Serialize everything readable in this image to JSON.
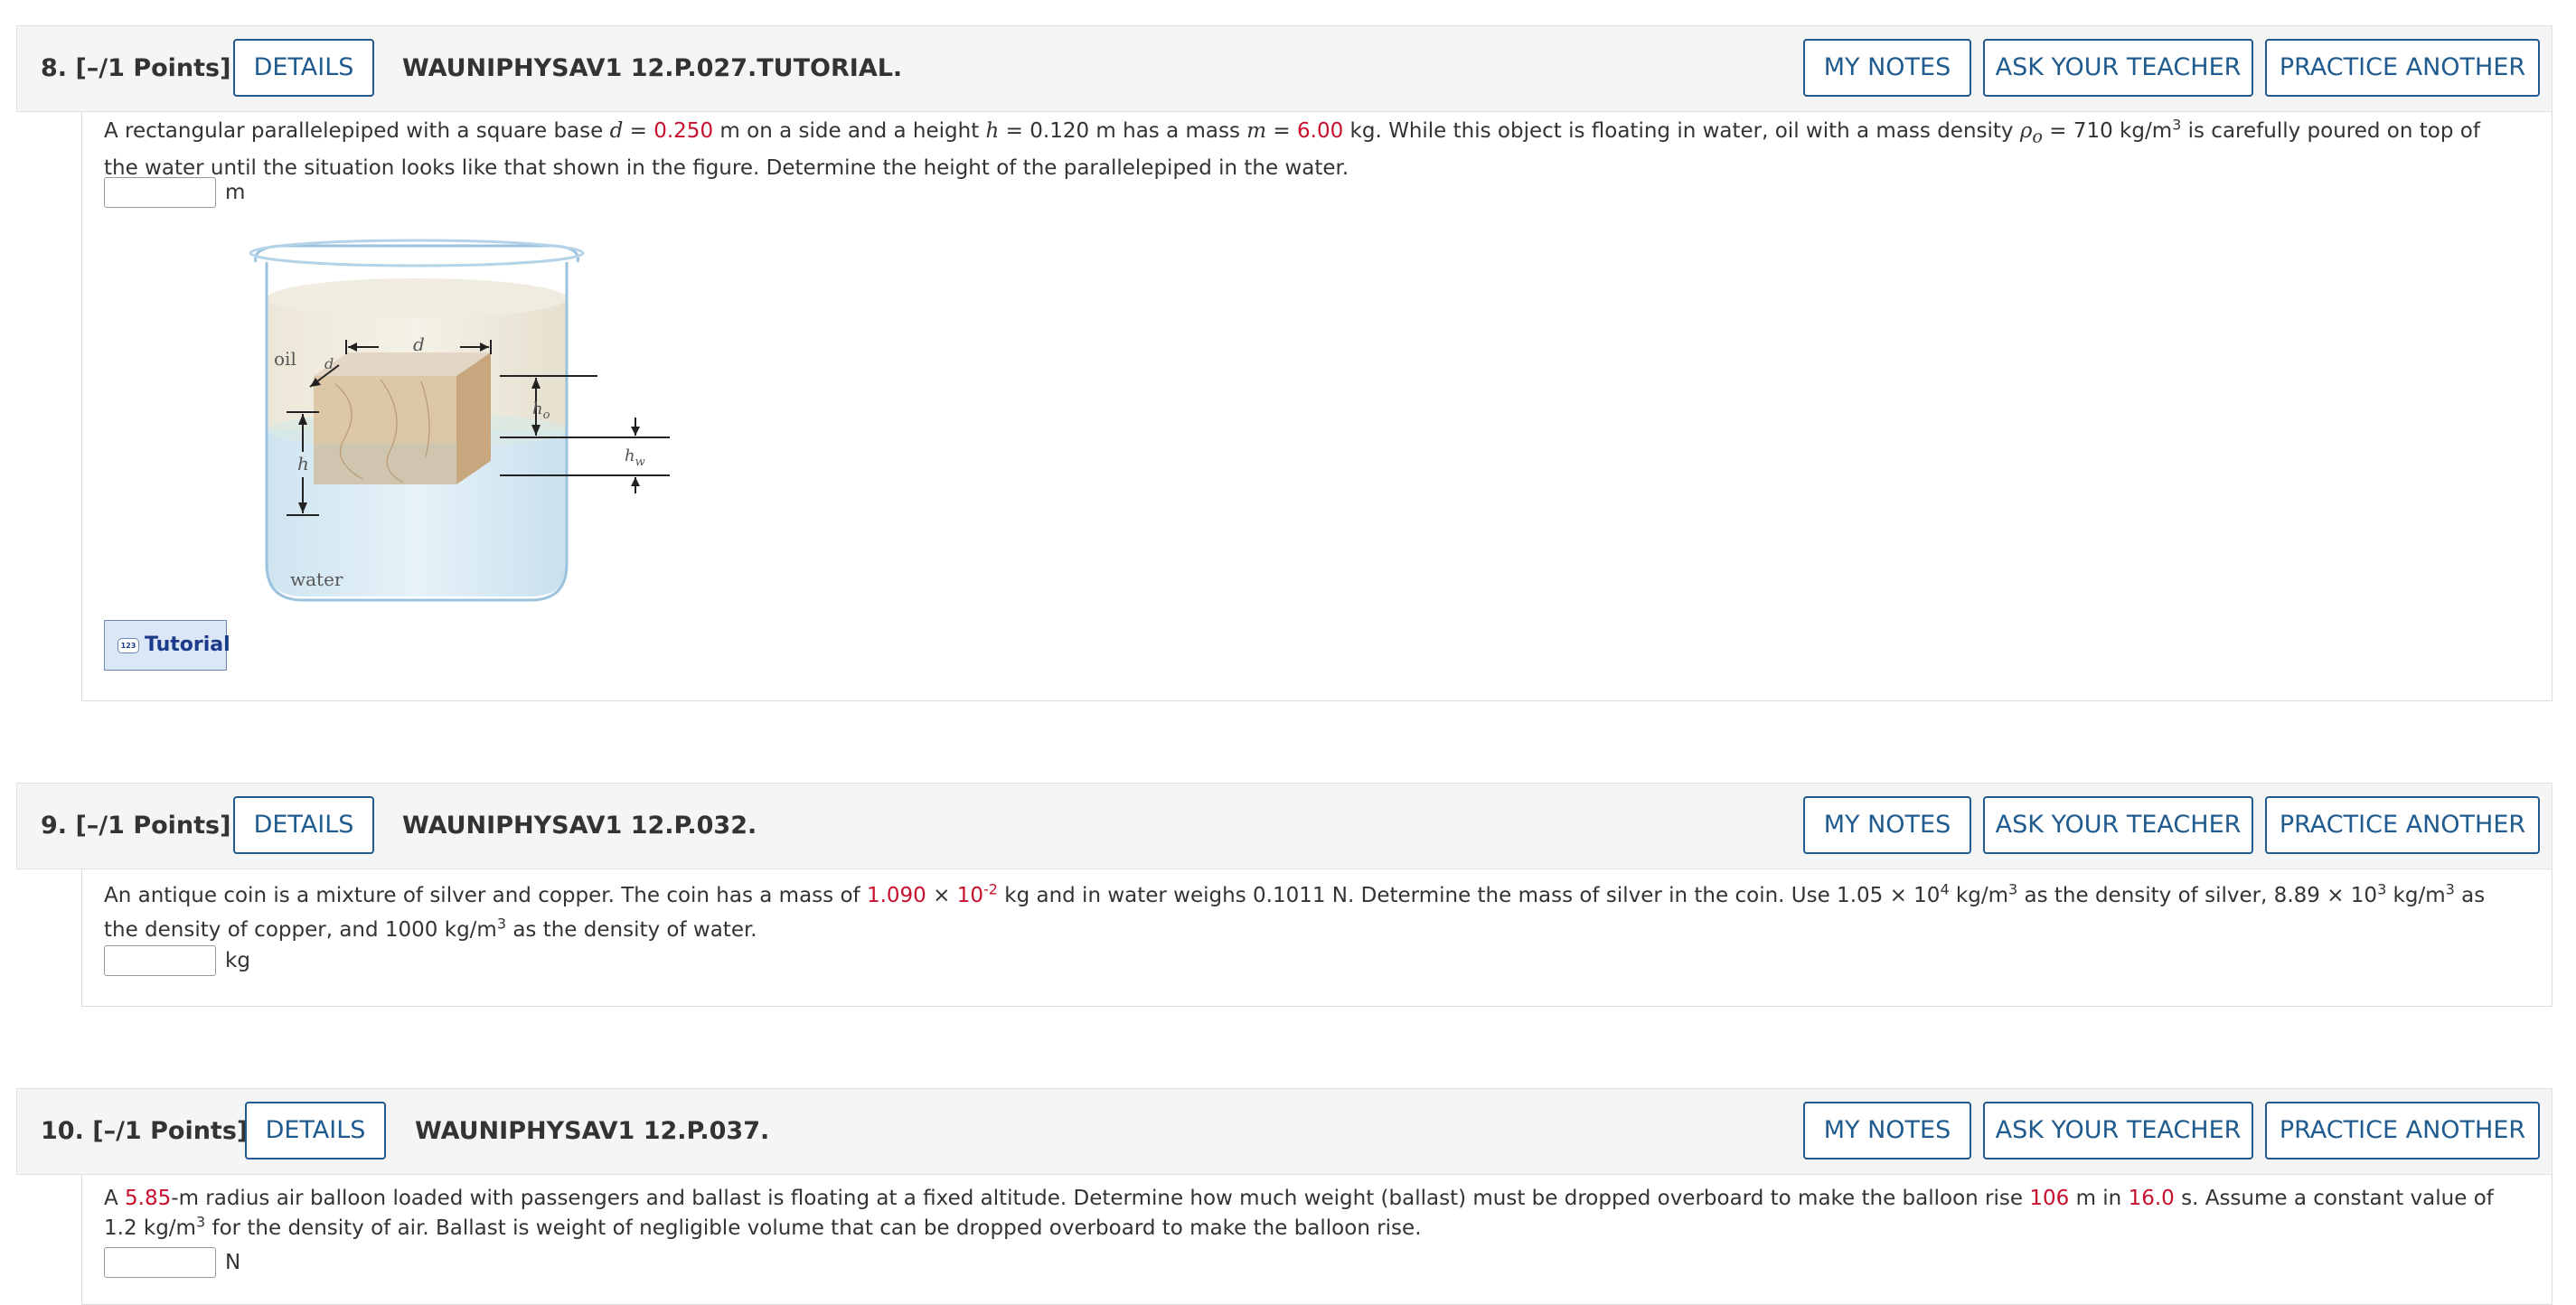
{
  "common": {
    "details": "DETAILS",
    "my_notes": "MY NOTES",
    "ask_teacher": "ASK YOUR TEACHER",
    "practice_another": "PRACTICE ANOTHER"
  },
  "q8": {
    "num": "8.  [–/1 Points]",
    "code": "WAUNIPHYSAV1 12.P.027.TUTORIAL.",
    "text": {
      "t1": "A rectangular parallelepiped with a square base ",
      "d_var": "d",
      "eq1": " = ",
      "d_val": "0.250",
      "t2": " m  on a side and a height  ",
      "h_var": "h",
      "t3": " = 0.120 m  has a mass  ",
      "m_var": "m",
      "eq2": " = ",
      "m_val": "6.00",
      "t4": " kg.  While this object is floating in water, oil with a mass density  ",
      "rho": "ρ",
      "rho_sub": "o",
      "t5": " = 710 kg/m",
      "sup3": "3",
      "t6": "  is carefully poured on top of the water until the situation looks like that shown in the figure. Determine the height of the parallelepiped in the water."
    },
    "unit": "m",
    "figure": {
      "oil": "oil",
      "water": "water",
      "d": "d",
      "h": "h",
      "ho": "h",
      "ho_sub": "o",
      "hw": "h",
      "hw_sub": "w"
    },
    "tutorial": "Tutorial",
    "tutorial_icon": "123"
  },
  "q9": {
    "num": "9.  [–/1 Points]",
    "code": "WAUNIPHYSAV1 12.P.032.",
    "text": {
      "t1": "An antique coin is a mixture of silver and copper. The coin has a mass of ",
      "mass": "1.090",
      "times": " × ",
      "ten": "10",
      "exp": "-2",
      "t2": " kg and in water weighs 0.1011 N. Determine the mass of silver in the coin. Use 1.05 × 10",
      "e4": "4",
      "t3": " kg/m",
      "s3a": "3",
      "t4": " as the density of silver, 8.89 × 10",
      "e3": "3",
      "t5": " kg/m",
      "s3b": "3",
      "t6": " as the density of copper, and 1000 kg/m",
      "s3c": "3",
      "t7": " as the density of water."
    },
    "unit": "kg"
  },
  "q10": {
    "num": "10.  [–/1 Points]",
    "code": "WAUNIPHYSAV1 12.P.037.",
    "text": {
      "t1": "A ",
      "r": "5.85",
      "t2": "-m radius air balloon loaded with passengers and ballast is floating at a fixed altitude. Determine how much weight (ballast) must be dropped overboard to make the balloon rise ",
      "dist": "106",
      "t3": " m in ",
      "time": "16.0",
      "t4": " s. Assume a constant value of 1.2 kg/m",
      "s3": "3",
      "t5": " for the density of air. Ballast is weight of negligible volume that can be dropped overboard to make the balloon rise."
    },
    "unit": "N"
  }
}
